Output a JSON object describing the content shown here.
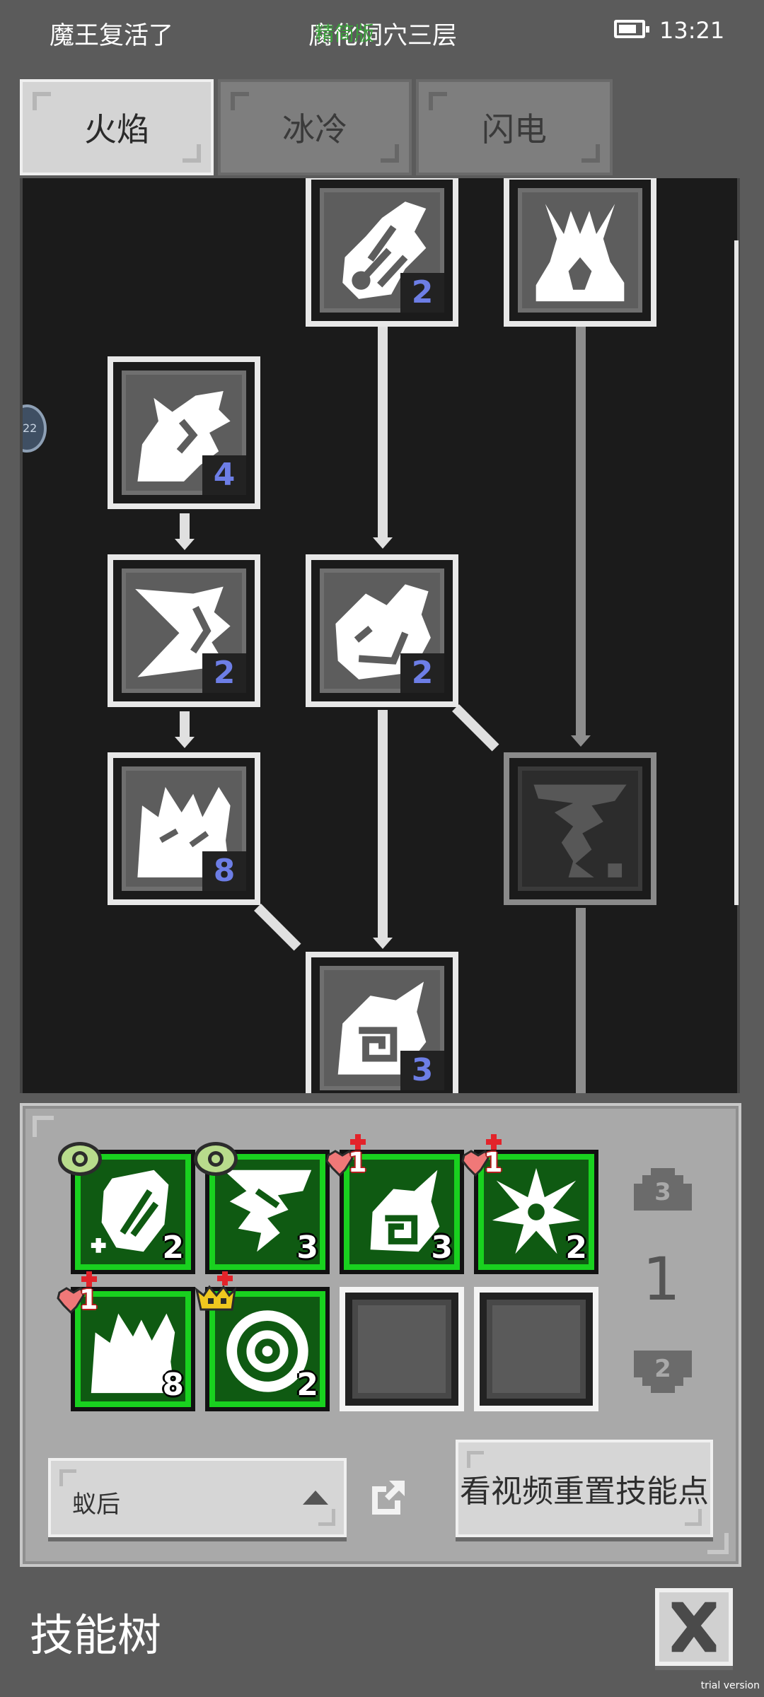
{
  "status_bar": {
    "left_text": "魔王复活了",
    "center_text": "腐化洞穴三层",
    "overlay_text": "精简版",
    "time": "13:21",
    "battery_icon": "battery-icon"
  },
  "tabs": [
    {
      "label": "火焰",
      "active": true
    },
    {
      "label": "冰冷",
      "active": false
    },
    {
      "label": "闪电",
      "active": false
    }
  ],
  "side_bubble": {
    "text": "22"
  },
  "tree": {
    "nodes": [
      {
        "id": "flame-feather",
        "level": "2",
        "icon": "flame-feather-icon"
      },
      {
        "id": "fire-pillar",
        "level": "",
        "icon": "fire-pillar-icon"
      },
      {
        "id": "fire-dragon",
        "level": "4",
        "icon": "fire-dragon-icon"
      },
      {
        "id": "fire-dash",
        "level": "2",
        "icon": "fire-dash-icon"
      },
      {
        "id": "fire-fist",
        "level": "2",
        "icon": "fire-fist-icon"
      },
      {
        "id": "fire-wave",
        "level": "8",
        "icon": "fire-wave-icon"
      },
      {
        "id": "locked-tornado",
        "level": "",
        "icon": "tornado-icon",
        "locked": true
      },
      {
        "id": "fire-spiral",
        "level": "3",
        "icon": "fire-spiral-icon"
      }
    ]
  },
  "loadout": {
    "slots": [
      {
        "level": "2",
        "badge": "eye",
        "badge_value": "",
        "icon": "shield-feather-icon"
      },
      {
        "level": "3",
        "badge": "eye",
        "badge_value": "",
        "icon": "fire-dash-icon"
      },
      {
        "level": "3",
        "badge": "heart",
        "badge_value": "1",
        "icon": "fire-spiral-icon"
      },
      {
        "level": "2",
        "badge": "heart",
        "badge_value": "1",
        "icon": "burst-icon"
      },
      {
        "level": "8",
        "badge": "heart",
        "badge_value": "1",
        "icon": "fire-wave-icon"
      },
      {
        "level": "2",
        "badge": "crown",
        "badge_value": "",
        "icon": "eye-ring-icon"
      },
      {
        "level": "",
        "badge": "",
        "badge_value": "",
        "icon": "",
        "empty": true
      },
      {
        "level": "",
        "badge": "",
        "badge_value": "",
        "icon": "",
        "empty": true
      }
    ],
    "counter_up": "3",
    "counter_value": "1",
    "counter_down": "2",
    "preset_label": "蚁后",
    "reset_button_label": "看视频重置技能点"
  },
  "footer": {
    "title": "技能树",
    "watermark": "trial version"
  },
  "colors": {
    "accent_green": "#19d11f",
    "level_blue": "#6d7ee6",
    "tree_bg": "#1b1b1b",
    "panel_bg": "#a9a9a9"
  }
}
